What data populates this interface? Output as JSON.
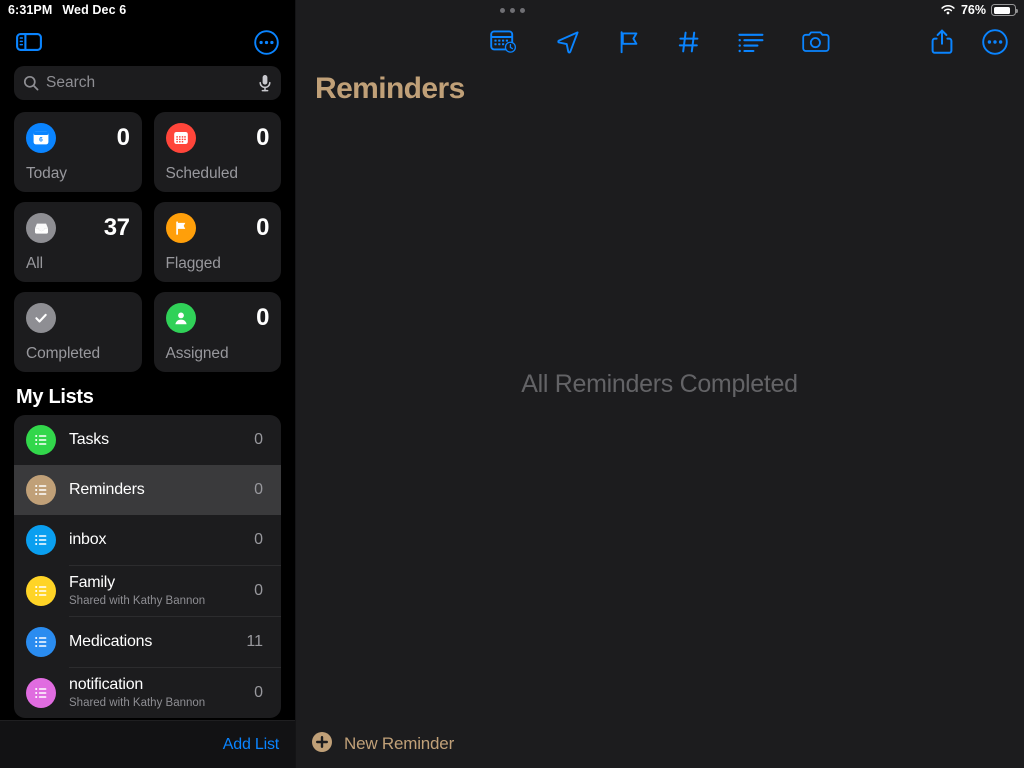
{
  "status_bar": {
    "time": "6:31PM",
    "date": "Wed Dec 6",
    "battery_percent": "76%",
    "wifi_icon": "wifi-icon",
    "battery_icon": "battery-icon",
    "multitask_handle": "multitasking-dots"
  },
  "sidebar": {
    "toggle_icon": "sidebar-toggle-icon",
    "more_icon": "more-options-icon",
    "search": {
      "placeholder": "Search",
      "search_icon": "search-icon",
      "mic_icon": "microphone-icon"
    },
    "smart_lists": [
      {
        "label": "Today",
        "count": "0",
        "icon": "today-calendar-icon",
        "color": "#0a84ff",
        "day": "6"
      },
      {
        "label": "Scheduled",
        "count": "0",
        "icon": "scheduled-calendar-icon",
        "color": "#ff453a"
      },
      {
        "label": "All",
        "count": "37",
        "icon": "all-tray-icon",
        "color": "#8e8e93"
      },
      {
        "label": "Flagged",
        "count": "0",
        "icon": "flag-icon",
        "color": "#ff9f0a"
      },
      {
        "label": "Completed",
        "count": "",
        "icon": "checkmark-icon",
        "color": "#8e8e93"
      },
      {
        "label": "Assigned",
        "count": "0",
        "icon": "person-icon",
        "color": "#30d158"
      }
    ],
    "my_lists_title": "My Lists",
    "lists": [
      {
        "name": "Tasks",
        "subtitle": "",
        "count": "0",
        "color": "#32d74b",
        "icon": "list-bullet-icon",
        "selected": false
      },
      {
        "name": "Reminders",
        "subtitle": "",
        "count": "0",
        "color": "#c0a078",
        "icon": "list-bullet-icon",
        "selected": true
      },
      {
        "name": "inbox",
        "subtitle": "",
        "count": "0",
        "color": "#0a9ff0",
        "icon": "list-bullet-icon",
        "selected": false
      },
      {
        "name": "Family",
        "subtitle": "Shared with Kathy Bannon",
        "count": "0",
        "color": "#ffd426",
        "icon": "list-bullet-icon",
        "selected": false
      },
      {
        "name": "Medications",
        "subtitle": "",
        "count": "11",
        "color": "#2a8cf0",
        "icon": "list-bullet-icon",
        "selected": false
      },
      {
        "name": "notification",
        "subtitle": "Shared with Kathy Bannon",
        "count": "0",
        "color": "#e06ce0",
        "icon": "list-bullet-icon",
        "selected": false
      }
    ],
    "add_list_label": "Add List",
    "add_list_color": "#0a84ff"
  },
  "main": {
    "title": "Reminders",
    "title_color": "#c0a078",
    "empty_state": "All Reminders Completed",
    "new_reminder_label": "New Reminder",
    "new_reminder_icon": "plus-circle-icon",
    "toolbar_icons": [
      "date-time-calendar-icon",
      "location-arrow-icon",
      "flag-icon",
      "tag-hash-icon",
      "list-indent-icon",
      "camera-icon"
    ],
    "share_icon": "share-icon",
    "more_icon": "more-options-icon",
    "accent_color": "#0a84ff"
  }
}
